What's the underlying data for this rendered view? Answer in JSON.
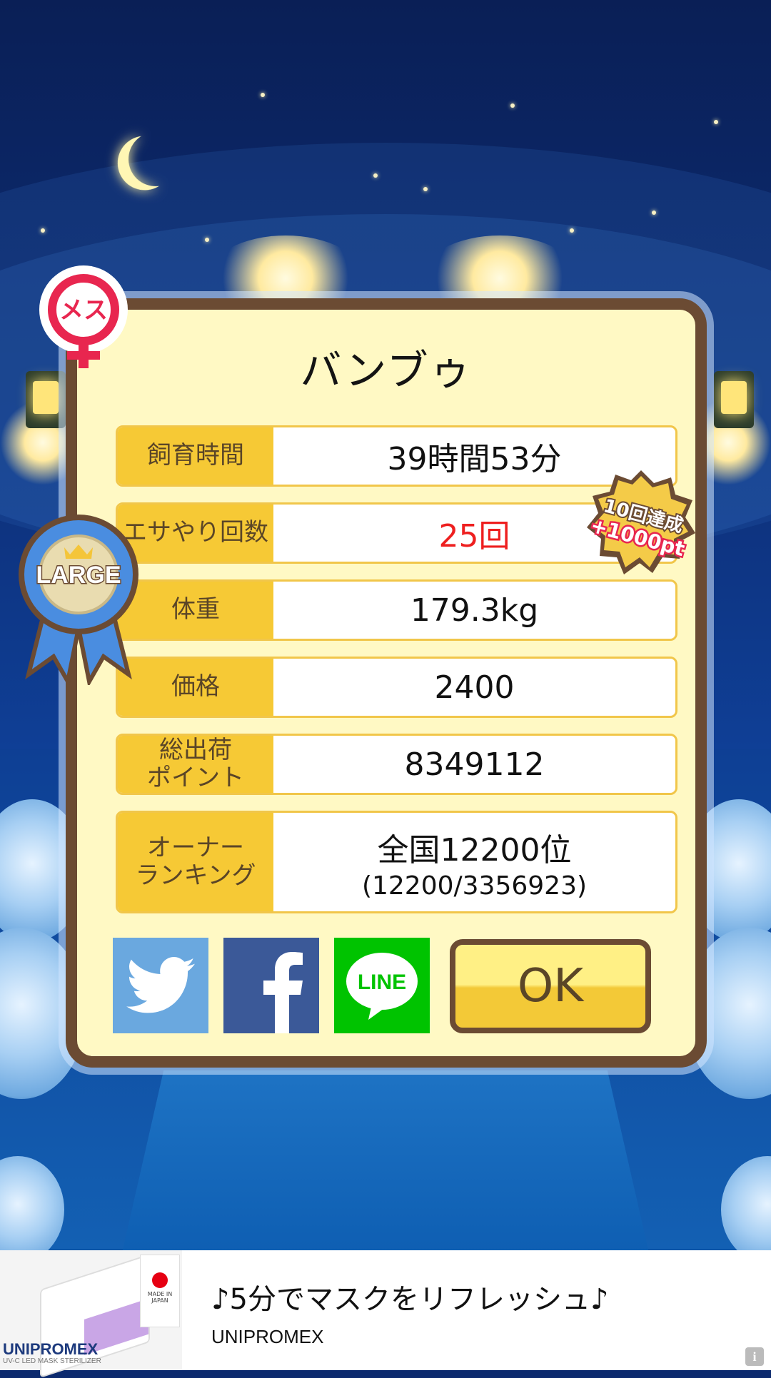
{
  "pet": {
    "name": "バンブゥ",
    "gender_badge": "メス",
    "size_badge": "LARGE"
  },
  "stats": [
    {
      "label": "飼育時間",
      "value": "39時間53分",
      "highlight": false
    },
    {
      "label": "エサやり回数",
      "value": "25回",
      "highlight": true
    },
    {
      "label": "体重",
      "value": "179.3kg",
      "highlight": false
    },
    {
      "label": "価格",
      "value": "2400",
      "highlight": false
    },
    {
      "label": "総出荷\nポイント",
      "value": "8349112",
      "highlight": false
    },
    {
      "label": "オーナー\nランキング",
      "value": "全国12200位",
      "sub": "(12200/3356923)",
      "highlight": false
    }
  ],
  "achievement": {
    "line1": "10回達成",
    "line2": "+1000pt"
  },
  "share": {
    "twitter_icon": "twitter-bird-icon",
    "facebook_icon": "facebook-f-icon",
    "line_label": "LINE"
  },
  "ok_label": "OK",
  "ad": {
    "title": "♪5分でマスクをリフレッシュ♪",
    "brand": "UNIPROMEX",
    "logo_text": "UNIPROMEX",
    "logo_sub": "UV-C LED MASK STERILIZER",
    "flag_text": "MADE IN JAPAN",
    "info_icon": "i"
  },
  "colors": {
    "label_bg": "#f6c935",
    "dialog_bg": "#fff9c4",
    "frame": "#6b4b33",
    "highlight_text": "#ee1f1f"
  }
}
